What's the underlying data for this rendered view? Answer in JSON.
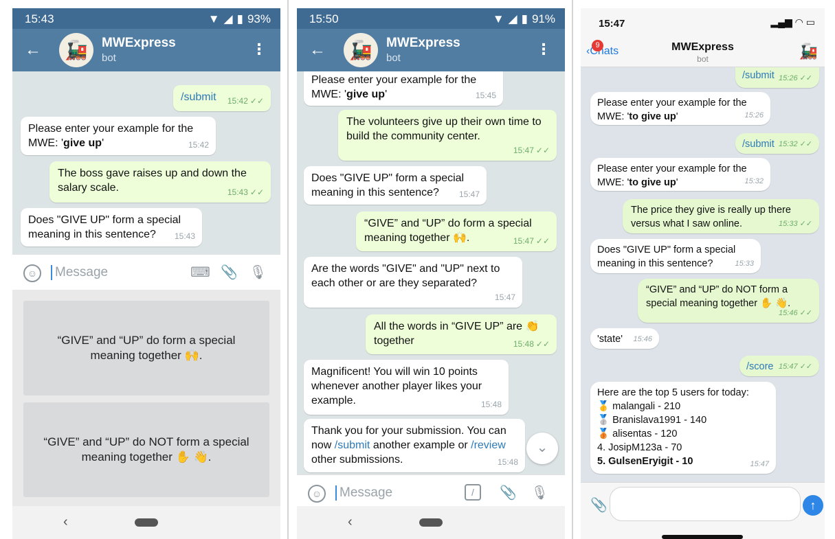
{
  "phone1": {
    "status": {
      "time": "15:43",
      "battery": "93%"
    },
    "header": {
      "title": "MWExpress",
      "subtitle": "bot"
    },
    "messages": [
      {
        "kind": "out",
        "text": "/submit",
        "time": "15:42"
      },
      {
        "kind": "in",
        "text_pre": "Please enter your example for the MWE: '",
        "bold": "give up",
        "text_post": "'",
        "time": "15:42"
      },
      {
        "kind": "out",
        "text": "The boss gave raises up and down the salary scale.",
        "time": "15:43"
      },
      {
        "kind": "in",
        "text": "Does \"GIVE UP\" form a special meaning in this sentence?",
        "time": "15:43"
      }
    ],
    "input_placeholder": "Message",
    "keyboard_buttons": [
      "“GIVE” and “UP” do form a special meaning together 🙌.",
      "“GIVE” and “UP” do NOT form a special meaning together ✋ 👋."
    ]
  },
  "phone2": {
    "status": {
      "time": "15:50",
      "battery": "91%"
    },
    "header": {
      "title": "MWExpress",
      "subtitle": "bot"
    },
    "messages": [
      {
        "kind": "in",
        "text_pre": "Please enter your example for the MWE: '",
        "bold": "give up",
        "text_post": "'",
        "time": "15:45"
      },
      {
        "kind": "out",
        "text": "The volunteers give up their own time to build the community center.",
        "time": "15:47"
      },
      {
        "kind": "in",
        "text": "Does \"GIVE UP\" form a special meaning in this sentence?",
        "time": "15:47"
      },
      {
        "kind": "out",
        "text": "“GIVE” and “UP” do form a special meaning together 🙌.",
        "time": "15:47"
      },
      {
        "kind": "in",
        "text": "Are the words \"GIVE\" and \"UP\" next to each other or are they separated?",
        "time": "15:47"
      },
      {
        "kind": "out",
        "text": "All the words in “GIVE UP” are 👏 together",
        "time": "15:48"
      },
      {
        "kind": "in",
        "text": "Magnificent! You will win 10 points whenever another player likes your example.",
        "time": "15:48"
      },
      {
        "kind": "in",
        "text_pre": "Thank you for your submission. You can now ",
        "link1": "/submit",
        "text_mid": " another example or ",
        "link2": "/review",
        "text_post": " other submissions.",
        "time": "15:48"
      }
    ],
    "input_placeholder": "Message"
  },
  "phone3": {
    "status": {
      "time": "15:47"
    },
    "header": {
      "back_label": "Chats",
      "unread_count": "9",
      "title": "MWExpress",
      "subtitle": "bot"
    },
    "messages": [
      {
        "kind": "out",
        "text": "/submit",
        "time": "15:26"
      },
      {
        "kind": "in",
        "text_pre": "Please enter your example for the MWE: '",
        "bold": "to give up",
        "text_post": "'",
        "time": "15:26"
      },
      {
        "kind": "out",
        "text": "/submit",
        "time": "15:32"
      },
      {
        "kind": "in",
        "text_pre": "Please enter your example for the MWE: '",
        "bold": "to give up",
        "text_post": "'",
        "time": "15:32"
      },
      {
        "kind": "out",
        "text": "The price they give is really up there versus what I saw online.",
        "time": "15:33"
      },
      {
        "kind": "in",
        "text": "Does \"GIVE UP\" form a special meaning in this sentence?",
        "time": "15:33"
      },
      {
        "kind": "out",
        "text": "“GIVE” and “UP” do NOT form a special meaning together ✋ 👋.",
        "time": "15:46"
      },
      {
        "kind": "in",
        "text": "'state'",
        "time": "15:46"
      },
      {
        "kind": "out",
        "text": "/score",
        "time": "15:47"
      },
      {
        "kind": "in",
        "text": "Here are the top 5 users for today:",
        "time": "15:47"
      }
    ],
    "leaderboard": [
      {
        "medal": "🥇",
        "entry": "malangali - 210"
      },
      {
        "medal": "🥈",
        "entry": "Branislava1991 - 140"
      },
      {
        "medal": "🥉",
        "entry": "alisentas - 120"
      },
      {
        "medal": "",
        "entry": "4. JosipM123a - 70"
      },
      {
        "medal": "",
        "entry": "5. GulsenEryigit - 10"
      }
    ]
  }
}
